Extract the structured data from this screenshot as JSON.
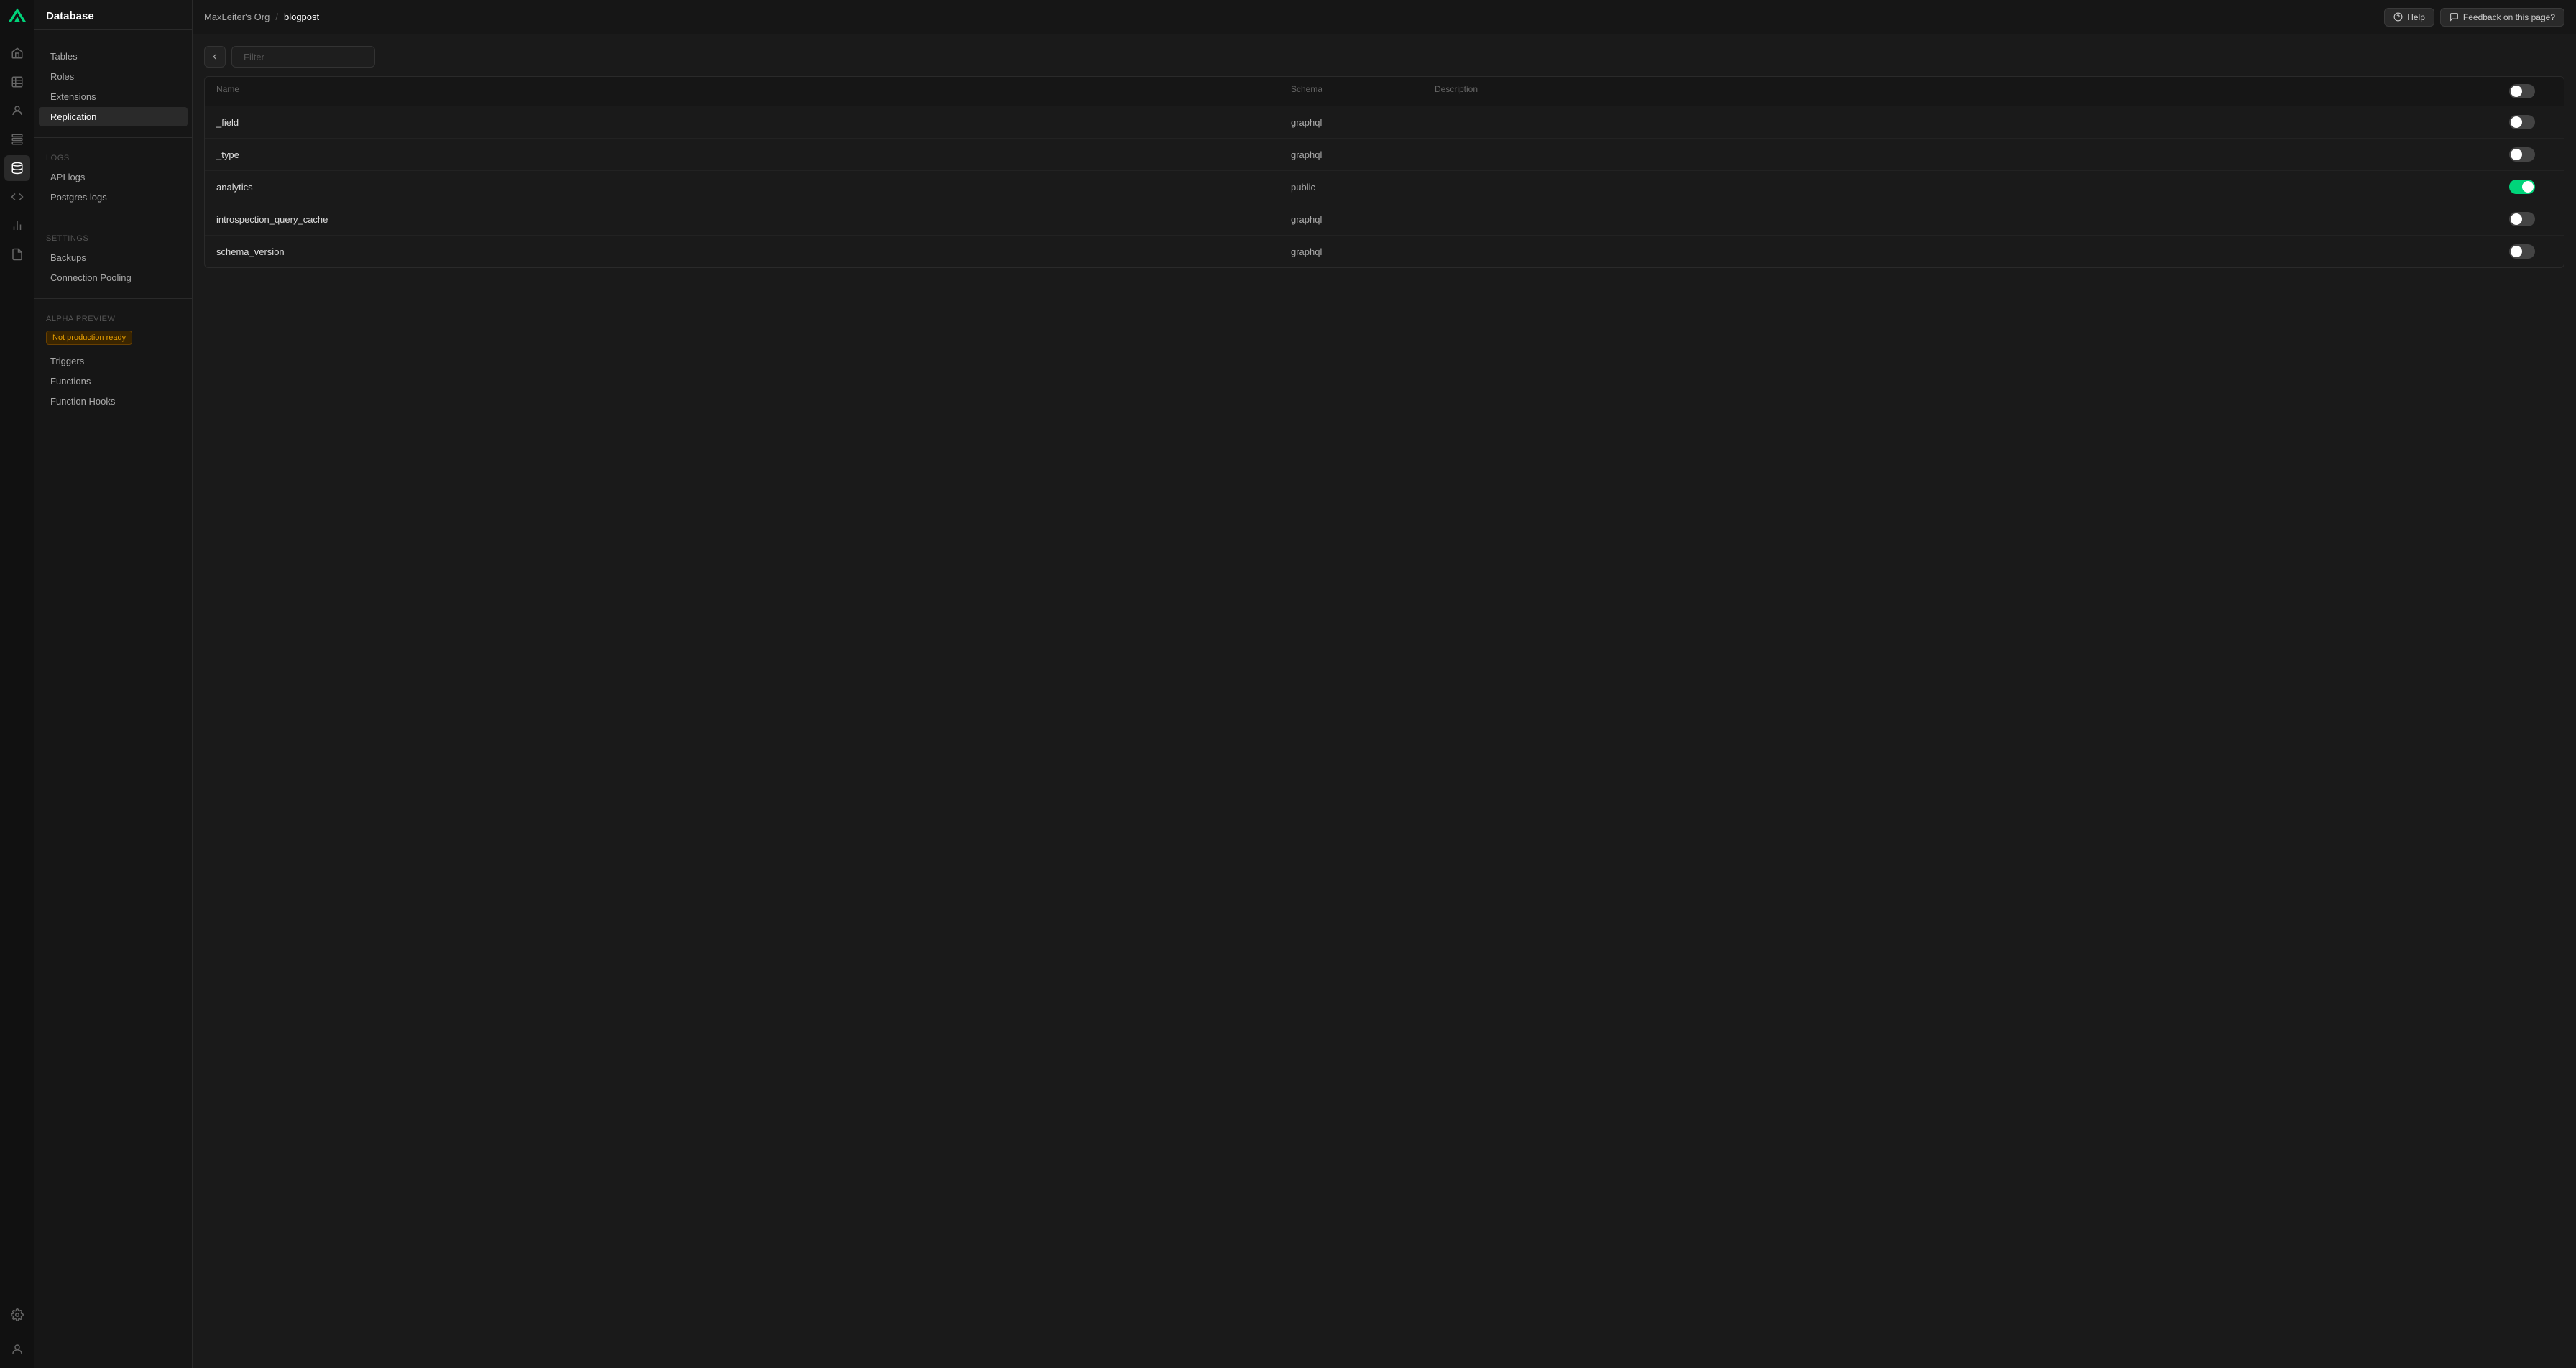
{
  "app": {
    "title": "Database"
  },
  "breadcrumb": {
    "org": "MaxLeiter's Org",
    "separator": "/",
    "project": "blogpost"
  },
  "topbar": {
    "help_label": "Help",
    "feedback_label": "Feedback on this page?"
  },
  "left_sidebar": {
    "header": "Database",
    "database_section": {
      "label": "",
      "items": [
        {
          "id": "tables",
          "label": "Tables",
          "active": false
        },
        {
          "id": "roles",
          "label": "Roles",
          "active": false
        },
        {
          "id": "extensions",
          "label": "Extensions",
          "active": false
        },
        {
          "id": "replication",
          "label": "Replication",
          "active": true
        }
      ]
    },
    "logs_section": {
      "label": "Logs",
      "items": [
        {
          "id": "api-logs",
          "label": "API logs",
          "active": false
        },
        {
          "id": "postgres-logs",
          "label": "Postgres logs",
          "active": false
        }
      ]
    },
    "settings_section": {
      "label": "Settings",
      "items": [
        {
          "id": "backups",
          "label": "Backups",
          "active": false
        },
        {
          "id": "connection-pooling",
          "label": "Connection Pooling",
          "active": false
        }
      ]
    },
    "alpha_section": {
      "label": "Alpha Preview",
      "badge": "Not production ready",
      "items": [
        {
          "id": "triggers",
          "label": "Triggers",
          "active": false
        },
        {
          "id": "functions",
          "label": "Functions",
          "active": false
        },
        {
          "id": "function-hooks",
          "label": "Function Hooks",
          "active": false
        }
      ]
    }
  },
  "filter": {
    "placeholder": "Filter"
  },
  "table": {
    "columns": [
      {
        "id": "name",
        "label": "Name"
      },
      {
        "id": "schema",
        "label": "Schema"
      },
      {
        "id": "description",
        "label": "Description"
      },
      {
        "id": "toggle",
        "label": ""
      }
    ],
    "rows": [
      {
        "name": "_field",
        "schema": "graphql",
        "description": "",
        "enabled": false
      },
      {
        "name": "_type",
        "schema": "graphql",
        "description": "",
        "enabled": false
      },
      {
        "name": "analytics",
        "schema": "public",
        "description": "",
        "enabled": true
      },
      {
        "name": "introspection_query_cache",
        "schema": "graphql",
        "description": "",
        "enabled": false
      },
      {
        "name": "schema_version",
        "schema": "graphql",
        "description": "",
        "enabled": false
      }
    ]
  },
  "icons": {
    "home": "⌂",
    "table": "⊞",
    "users": "👤",
    "storage": "◫",
    "database": "🗄",
    "api": "</>",
    "chart": "📊",
    "file": "📄",
    "settings": "⚙",
    "search": "🔍",
    "back": "‹",
    "help": "?",
    "feedback": "💬"
  }
}
